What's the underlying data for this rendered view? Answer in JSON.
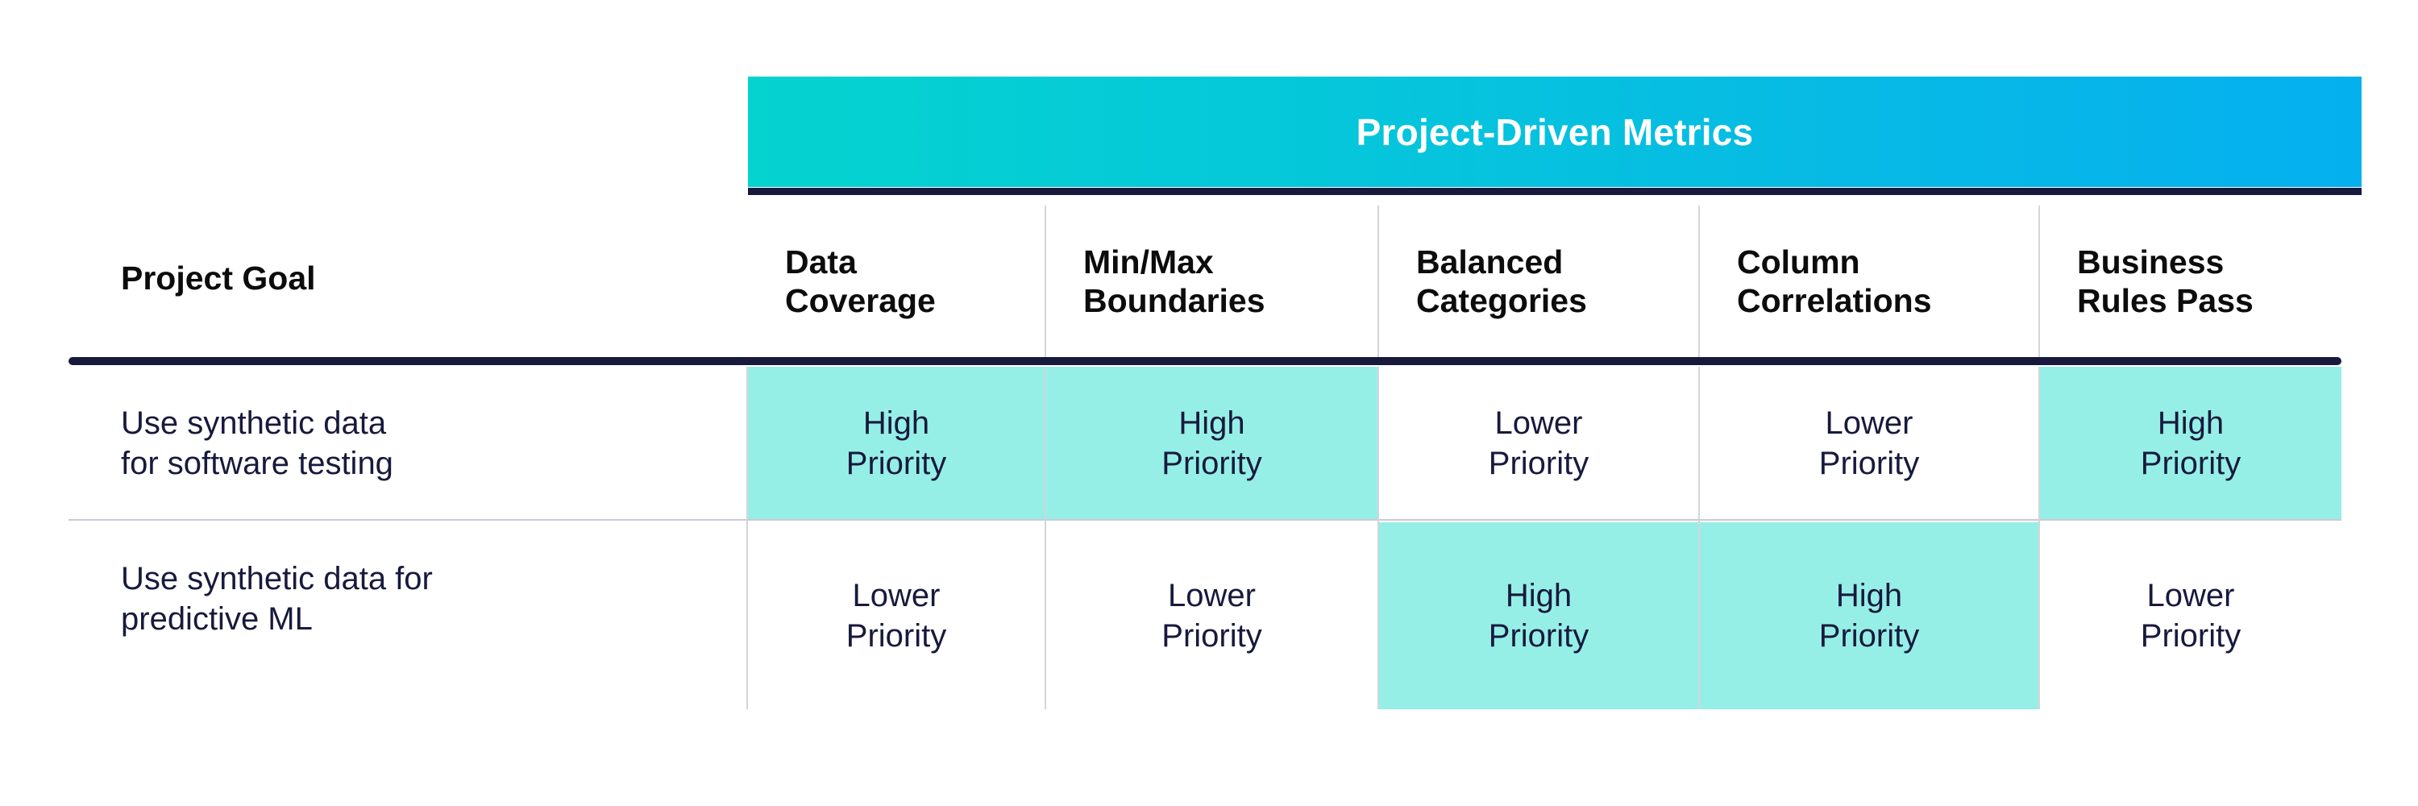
{
  "banner": {
    "title": "Project-Driven Metrics"
  },
  "colors": {
    "gradient_start": "#05D3CF",
    "gradient_end": "#05B0EF",
    "highlight": "#96EFE7",
    "rule": "#171A3C",
    "text_dark": "#171A3C",
    "header_text": "#0c0c0c",
    "divider": "#d3d5da"
  },
  "table": {
    "goal_column_header": "Project Goal",
    "metric_headers": [
      {
        "line1": "Data",
        "line2": "Coverage"
      },
      {
        "line1": "Min/Max",
        "line2": "Boundaries"
      },
      {
        "line1": "Balanced",
        "line2": "Categories"
      },
      {
        "line1": "Column",
        "line2": "Correlations"
      },
      {
        "line1": "Business",
        "line2": "Rules Pass"
      }
    ],
    "rows": [
      {
        "goal": {
          "line1": "Use synthetic data",
          "line2": "for software testing"
        },
        "cells": [
          {
            "line1": "High",
            "line2": "Priority",
            "highlight": true
          },
          {
            "line1": "High",
            "line2": "Priority",
            "highlight": true
          },
          {
            "line1": "Lower",
            "line2": "Priority",
            "highlight": false
          },
          {
            "line1": "Lower",
            "line2": "Priority",
            "highlight": false
          },
          {
            "line1": "High",
            "line2": "Priority",
            "highlight": true
          }
        ]
      },
      {
        "goal": {
          "line1": "Use synthetic data for",
          "line2": "predictive ML"
        },
        "cells": [
          {
            "line1": "Lower",
            "line2": "Priority",
            "highlight": false
          },
          {
            "line1": "Lower",
            "line2": "Priority",
            "highlight": false
          },
          {
            "line1": "High",
            "line2": "Priority",
            "highlight": true
          },
          {
            "line1": "High",
            "line2": "Priority",
            "highlight": true
          },
          {
            "line1": "Lower",
            "line2": "Priority",
            "highlight": false
          }
        ]
      }
    ]
  }
}
